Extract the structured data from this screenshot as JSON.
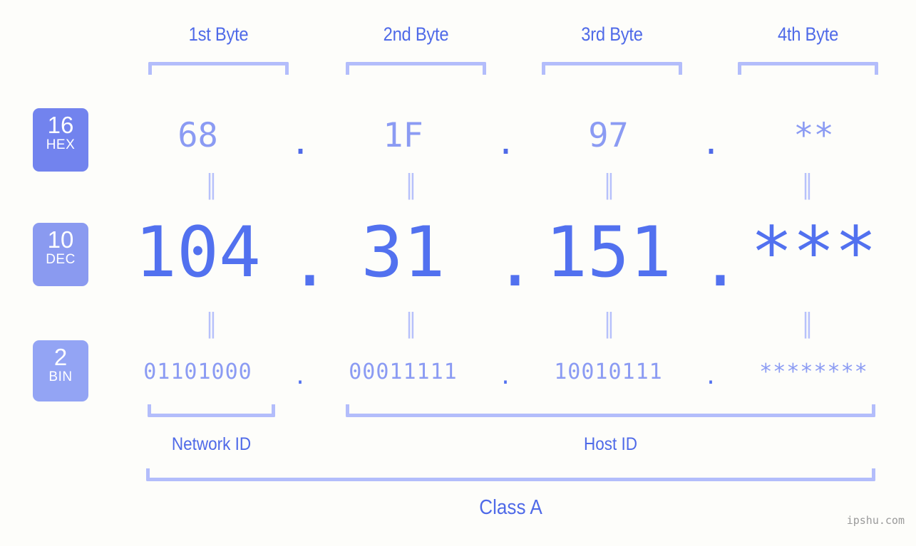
{
  "page": {
    "background_color": "#fdfdfa",
    "accent_color": "#4f6ae8",
    "light_accent_color": "#b3bdfb",
    "watermark": "ipshu.com"
  },
  "byte_headers": [
    {
      "label": "1st Byte"
    },
    {
      "label": "2nd Byte"
    },
    {
      "label": "3rd Byte"
    },
    {
      "label": "4th Byte"
    }
  ],
  "radix_badges": [
    {
      "base": "16",
      "system": "HEX",
      "color": "#7283ee"
    },
    {
      "base": "10",
      "system": "DEC",
      "color": "#8a9af0"
    },
    {
      "base": "2",
      "system": "BIN",
      "color": "#93a4f4"
    }
  ],
  "separator": ".",
  "equals_mark": "‖",
  "rows": {
    "hex": {
      "bytes": [
        "68",
        "1F",
        "97",
        "**"
      ]
    },
    "dec": {
      "bytes": [
        "104",
        "31",
        "151",
        "***"
      ]
    },
    "bin": {
      "bytes": [
        "01101000",
        "00011111",
        "10010111",
        "********"
      ]
    }
  },
  "sections": {
    "network_id": "Network ID",
    "host_id": "Host ID",
    "class": "Class A"
  }
}
